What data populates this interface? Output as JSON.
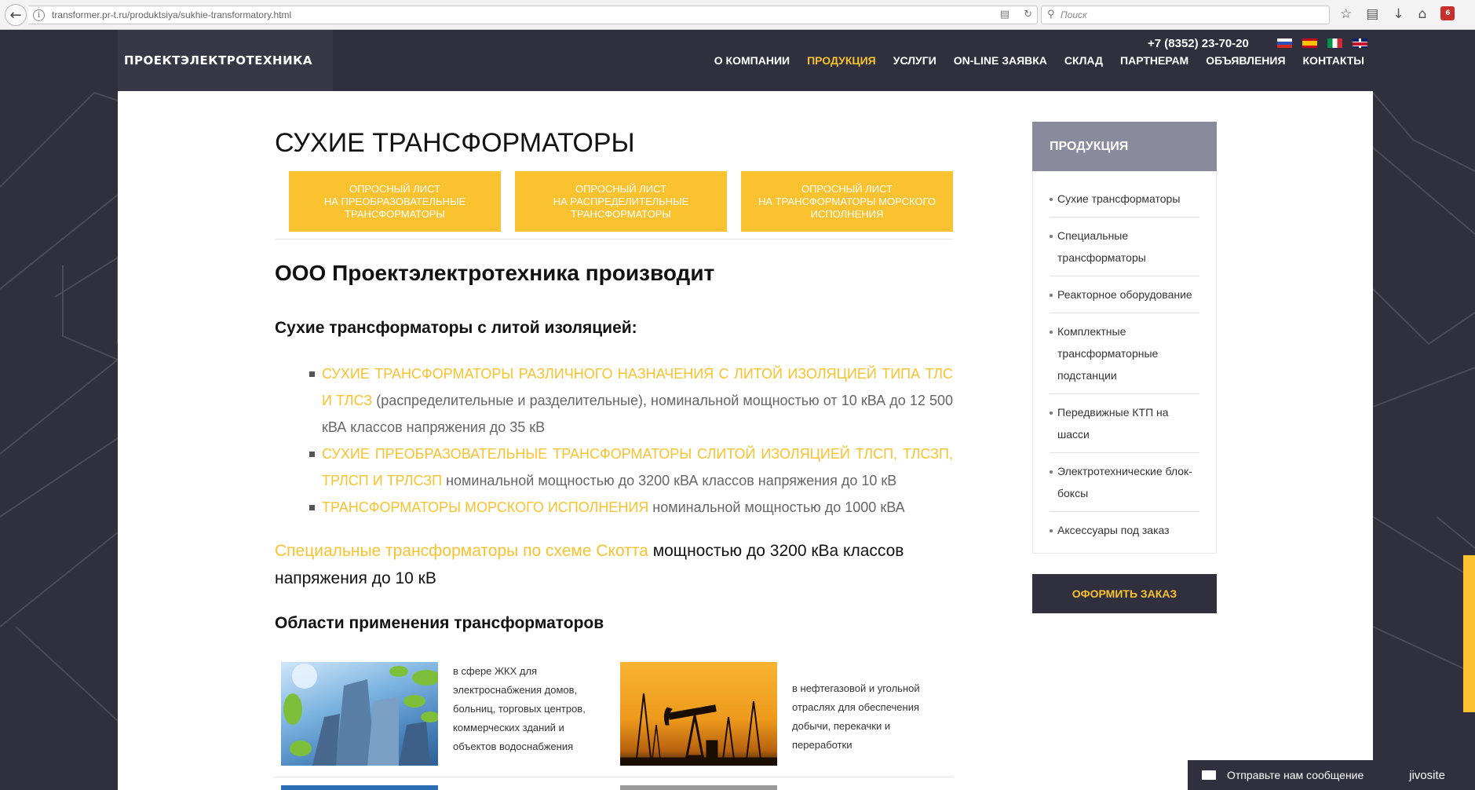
{
  "browser": {
    "url": "transformer.pr-t.ru/produktsiya/sukhie-transformatory.html",
    "search_placeholder": "Поиск",
    "ext_badge": "6"
  },
  "header": {
    "logo": "ПРОЕКТЭЛЕКТРОТЕХНИКА",
    "phone": "+7 (8352) 23-70-20",
    "languages": [
      "ru",
      "es",
      "it",
      "en"
    ],
    "nav": [
      "О КОМПАНИИ",
      "ПРОДУКЦИЯ",
      "УСЛУГИ",
      "ON-LINE ЗАЯВКА",
      "СКЛАД",
      "ПАРТНЕРАМ",
      "ОБЪЯВЛЕНИЯ",
      "КОНТАКТЫ"
    ],
    "active_nav": "ПРОДУКЦИЯ"
  },
  "main": {
    "title": "СУХИЕ ТРАНСФОРМАТОРЫ",
    "buttons": [
      [
        "ОПРОСНЫЙ ЛИСТ",
        "НА ПРЕОБРАЗОВАТЕЛЬНЫЕ",
        "ТРАНСФОРМАТОРЫ"
      ],
      [
        "ОПРОСНЫЙ ЛИСТ",
        "НА РАСПРЕДЕЛИТЕЛЬНЫЕ",
        "ТРАНСФОРМАТОРЫ"
      ],
      [
        "ОПРОСНЫЙ ЛИСТ",
        "НА ТРАНСФОРМАТОРЫ МОРСКОГО",
        "ИСПОЛНЕНИЯ"
      ]
    ],
    "subtitle": "ООО Проектэлектротехника производит",
    "cast_heading": "Сухие трансформаторы с литой изоляцией:",
    "bullets": [
      {
        "link": "СУХИЕ ТРАНСФОРМАТОРЫ РАЗЛИЧНОГО НАЗНАЧЕНИЯ С ЛИТОЙ ИЗОЛЯЦИЕЙ ТИПА ТЛС И ТЛСЗ",
        "text": " (распределительные и разделительные), номинальной мощностью от 10 кВА до 12 500 кВА классов напряжения до 35 кВ"
      },
      {
        "link": "СУХИЕ ПРЕОБРАЗОВАТЕЛЬНЫЕ ТРАНСФОРМАТОРЫ СЛИТОЙ ИЗОЛЯЦИЕЙ ТЛСП, ТЛСЗП, ТРЛСП И ТРЛСЗП",
        "text": " номинальной мощностью до 3200 кВА классов напряжения до 10 кВ"
      },
      {
        "link": "ТРАНСФОРМАТОРЫ МОРСКОГО ИСПОЛНЕНИЯ",
        "text": " номинальной мощностью до 1000 кВА"
      }
    ],
    "scott_link": "Специальные трансформаторы по схеме Скотта",
    "scott_text": " мощностью до 3200 кВа классов напряжения до 10 кВ",
    "areas_title": "Области применения трансформаторов",
    "areas": [
      {
        "text": "в сфере ЖКХ для электроснабжения домов, больниц, торговых центров, коммерческих зданий и объектов водоснабжения"
      },
      {
        "text": "в нефтегазовой и угольной отраслях для обеспечения добычи, перекачки и переработки"
      }
    ]
  },
  "sidebar": {
    "title": "ПРОДУКЦИЯ",
    "items": [
      "Сухие трансформаторы",
      "Специальные трансформаторы",
      "Реакторное оборудование",
      "Комплектные трансформаторные подстанции",
      "Передвижные КТП на шасси",
      "Электротехнические блок-боксы",
      "Аксессуары под заказ"
    ],
    "order_button": "ОФОРМИТЬ ЗАКАЗ"
  },
  "jivo": {
    "message": "Отправьте нам сообщение",
    "brand": "jivosite"
  },
  "colors": {
    "accent": "#f9c22e",
    "dark": "#2f2f3d",
    "sidebar_head": "#8a8a9e"
  }
}
